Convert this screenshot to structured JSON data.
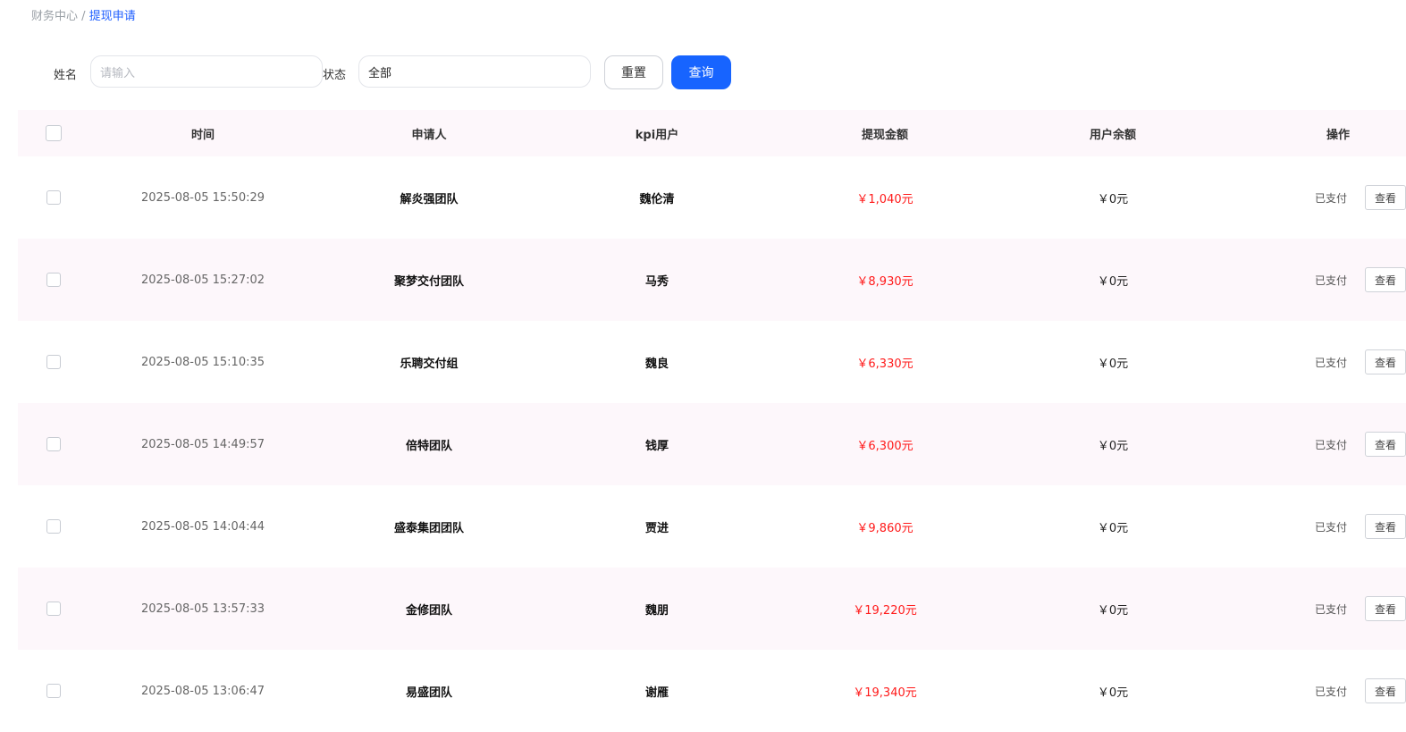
{
  "breadcrumb": {
    "parent": "财务中心",
    "separator": "/",
    "current": "提现申请"
  },
  "filters": {
    "name_label": "姓名",
    "name_placeholder": "请输入",
    "status_label": "状态",
    "status_value": "全部",
    "reset_label": "重置",
    "query_label": "查询"
  },
  "table": {
    "headers": {
      "time": "时间",
      "applicant": "申请人",
      "kpi_user": "kpi用户",
      "amount": "提现金额",
      "balance": "用户余额",
      "action": "操作"
    },
    "rows": [
      {
        "time": "2025-08-05 15:50:29",
        "applicant": "解炎强团队",
        "kpi_user": "魏伦清",
        "amount": "￥1,040元",
        "balance": "￥0元",
        "status": "已支付",
        "view": "查看"
      },
      {
        "time": "2025-08-05 15:27:02",
        "applicant": "聚梦交付团队",
        "kpi_user": "马秀",
        "amount": "￥8,930元",
        "balance": "￥0元",
        "status": "已支付",
        "view": "查看"
      },
      {
        "time": "2025-08-05 15:10:35",
        "applicant": "乐聘交付组",
        "kpi_user": "魏良",
        "amount": "￥6,330元",
        "balance": "￥0元",
        "status": "已支付",
        "view": "查看"
      },
      {
        "time": "2025-08-05 14:49:57",
        "applicant": "倍特团队",
        "kpi_user": "钱厚",
        "amount": "￥6,300元",
        "balance": "￥0元",
        "status": "已支付",
        "view": "查看"
      },
      {
        "time": "2025-08-05 14:04:44",
        "applicant": "盛泰集团团队",
        "kpi_user": "贾进",
        "amount": "￥9,860元",
        "balance": "￥0元",
        "status": "已支付",
        "view": "查看"
      },
      {
        "time": "2025-08-05 13:57:33",
        "applicant": "金修团队",
        "kpi_user": "魏朋",
        "amount": "￥19,220元",
        "balance": "￥0元",
        "status": "已支付",
        "view": "查看"
      },
      {
        "time": "2025-08-05 13:06:47",
        "applicant": "易盛团队",
        "kpi_user": "谢雁",
        "amount": "￥19,340元",
        "balance": "￥0元",
        "status": "已支付",
        "view": "查看"
      }
    ]
  }
}
